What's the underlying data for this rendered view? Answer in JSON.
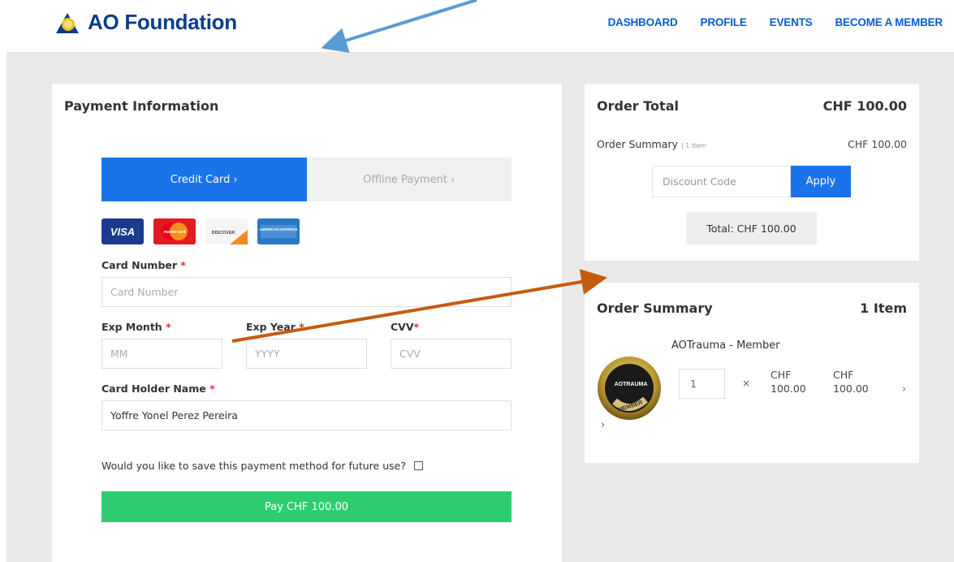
{
  "header": {
    "logo_text": "AO Foundation",
    "nav": [
      "DASHBOARD",
      "PROFILE",
      "EVENTS",
      "BECOME A MEMBER"
    ]
  },
  "payment": {
    "title": "Payment Information",
    "tabs": [
      "Credit Card ›",
      "Offline Payment ›"
    ],
    "card_brands": [
      "VISA",
      "mastercard",
      "DISCOVER",
      "AMERICAN EXPRESS"
    ],
    "card_number_label": "Card Number",
    "card_number_placeholder": "Card Number",
    "exp_month_label": "Exp Month",
    "exp_month_placeholder": "MM",
    "exp_year_label": "Exp Year",
    "exp_year_placeholder": "YYYY",
    "cvv_label": "CVV",
    "cvv_placeholder": "CVV",
    "holder_label": "Card Holder Name",
    "holder_value": "Yoffre Yonel Perez Pereira",
    "required_mark": "*",
    "save_question": "Would you like to save this payment method for future use?",
    "pay_button": "Pay CHF 100.00"
  },
  "order_total": {
    "title": "Order Total",
    "amount": "CHF 100.00",
    "summary_label": "Order Summary",
    "summary_count": "| 1 Item",
    "summary_amount": "CHF 100.00",
    "discount_placeholder": "Discount Code",
    "apply_label": "Apply",
    "total_label": "Total: CHF 100.00"
  },
  "order_summary": {
    "title": "Order Summary",
    "count": "1 Item",
    "product_name": "AOTrauma - Member",
    "badge_top": "AOTRAUMA",
    "badge_bottom": "MEMBER",
    "quantity": "1",
    "times": "×",
    "unit_price_currency": "CHF",
    "unit_price_value": "100.00",
    "line_total_currency": "CHF",
    "line_total_value": "100.00",
    "chevron": "›"
  },
  "colors": {
    "brand_blue": "#0b3d8c",
    "nav_blue": "#0a5bd0",
    "primary": "#1a73e8",
    "success": "#2ecc71",
    "annotation_arrow_1": "#5b9bd5",
    "annotation_arrow_2": "#c55a11"
  }
}
